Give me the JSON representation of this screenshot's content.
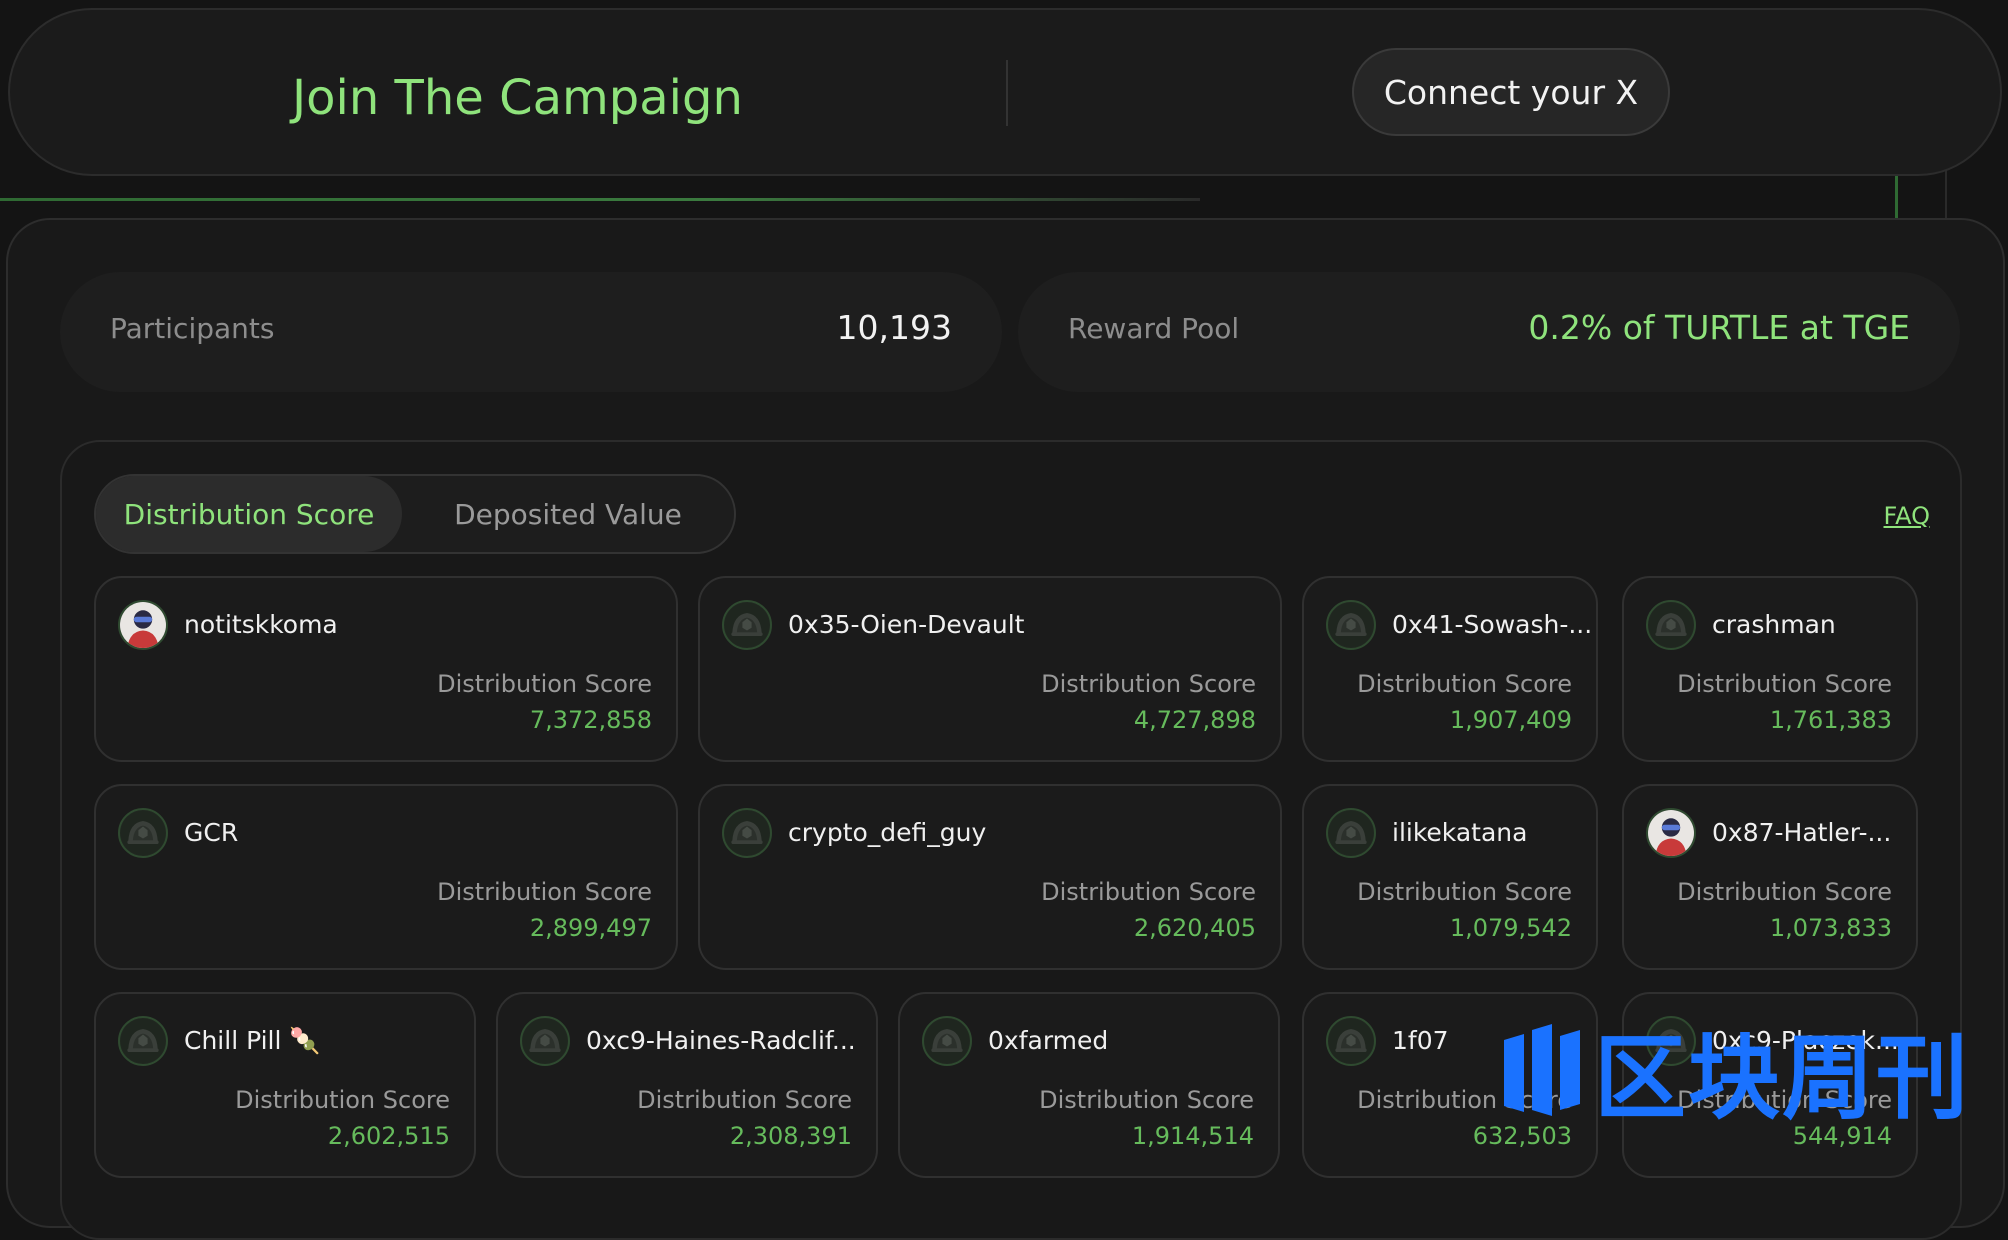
{
  "header": {
    "title": "Join The Campaign",
    "connect_label": "Connect your X"
  },
  "stats": {
    "participants_label": "Participants",
    "participants_value": "10,193",
    "reward_label": "Reward Pool",
    "reward_value": "0.2% of TURTLE at TGE"
  },
  "tabs": {
    "active": "Distribution Score",
    "inactive": "Deposited Value"
  },
  "faq_label": "FAQ",
  "leaderboard": [
    {
      "name": "notitskkoma",
      "label": "Distribution Score",
      "value": "7,372,858",
      "avatar": "user-photo-icon"
    },
    {
      "name": "0x35-Oien-Devault",
      "label": "Distribution Score",
      "value": "4,727,898",
      "avatar": "turtle-avatar-icon"
    },
    {
      "name": "0x41-Sowash-...",
      "label": "Distribution Score",
      "value": "1,907,409",
      "avatar": "turtle-avatar-icon"
    },
    {
      "name": "crashman",
      "label": "Distribution Score",
      "value": "1,761,383",
      "avatar": "turtle-avatar-icon"
    },
    {
      "name": "GCR",
      "label": "Distribution Score",
      "value": "2,899,497",
      "avatar": "turtle-avatar-icon"
    },
    {
      "name": "crypto_defi_guy",
      "label": "Distribution Score",
      "value": "2,620,405",
      "avatar": "turtle-avatar-icon"
    },
    {
      "name": "ilikekatana",
      "label": "Distribution Score",
      "value": "1,079,542",
      "avatar": "turtle-avatar-icon"
    },
    {
      "name": "0x87-Hatler-...",
      "label": "Distribution Score",
      "value": "1,073,833",
      "avatar": "user-photo-icon"
    },
    {
      "name": "Chill Pill 🍡",
      "label": "Distribution Score",
      "value": "2,602,515",
      "avatar": "turtle-avatar-icon"
    },
    {
      "name": "0xc9-Haines-Radclif...",
      "label": "Distribution Score",
      "value": "2,308,391",
      "avatar": "turtle-avatar-icon"
    },
    {
      "name": "0xfarmed",
      "label": "Distribution Score",
      "value": "1,914,514",
      "avatar": "turtle-avatar-icon"
    },
    {
      "name": "1f07",
      "label": "Distribution Score",
      "value": "632,503",
      "avatar": "turtle-avatar-icon"
    },
    {
      "name": "0xc9-Placzek...",
      "label": "Distribution Score",
      "value": "544,914",
      "avatar": "turtle-avatar-icon"
    }
  ],
  "watermark": "区块周刊",
  "colors": {
    "accent_green": "#8fe37c",
    "score_green": "#66bb5c",
    "background": "#141414",
    "watermark_blue": "#1a72ff"
  }
}
